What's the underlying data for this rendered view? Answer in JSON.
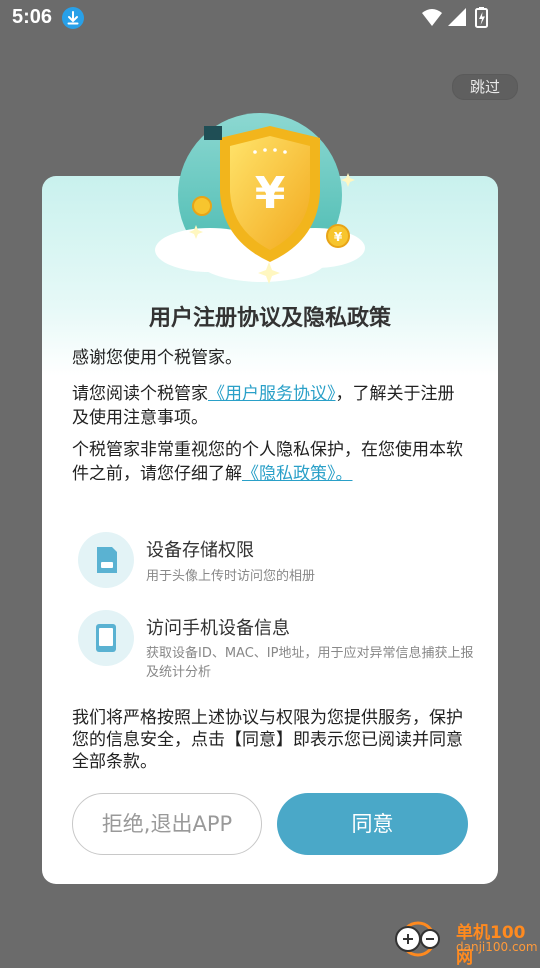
{
  "status_bar": {
    "time": "5:06",
    "icons": [
      "download-icon",
      "wifi-icon",
      "signal-icon",
      "battery-charging-icon"
    ]
  },
  "skip_label": "跳过",
  "dialog": {
    "title": "用户注册协议及隐私政策",
    "p1": "感谢您使用个税管家。",
    "p2_prefix": "请您阅读个税管家",
    "p2_link": "《用户服务协议》",
    "p2_suffix": "，了解关于注册及使用注意事项。",
    "p3_prefix": "个税管家非常重视您的个人隐私保护，在您使用本软件之前，请您仔细了解",
    "p3_link": "《隐私政策》。",
    "permissions": [
      {
        "icon": "storage-card-icon",
        "title": "设备存储权限",
        "desc": "用于头像上传时访问您的相册"
      },
      {
        "icon": "phone-device-icon",
        "title": "访问手机设备信息",
        "desc": "获取设备ID、MAC、IP地址，用于应对异常信息捕获上报及统计分析"
      }
    ],
    "closing": "我们将严格按照上述协议与权限为您提供服务，保护您的信息安全，点击【同意】即表示您已阅读并同意全部条款。",
    "reject_label": "拒绝,退出APP",
    "agree_label": "同意"
  },
  "watermark": {
    "name": "单机100网",
    "url": "danji100.com"
  },
  "colors": {
    "accent": "#4aa8c8",
    "link": "#2aa0c8",
    "overlay": "#6b6b6b",
    "shield": "#f6c93a",
    "watermark": "#ff8a1f"
  }
}
